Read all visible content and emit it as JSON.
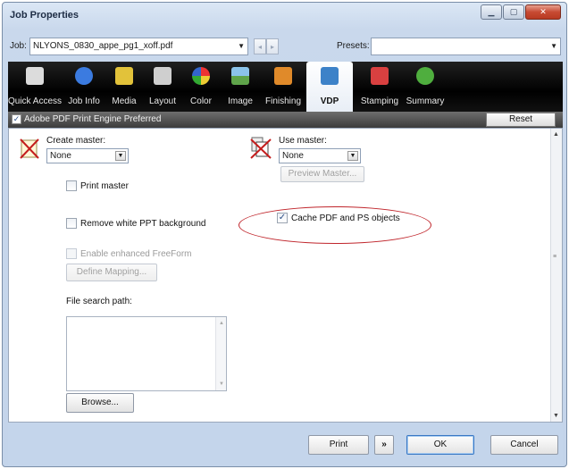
{
  "window": {
    "title": "Job Properties"
  },
  "job": {
    "label": "Job:",
    "value": "NLYONS_0830_appe_pg1_xoff.pdf",
    "presets_label": "Presets:",
    "presets_value": ""
  },
  "tabs": [
    {
      "label": "Quick Access",
      "icon": "quick-access-icon",
      "color": "#d8d8d8"
    },
    {
      "label": "Job Info",
      "icon": "info-icon",
      "color": "#3b7be0"
    },
    {
      "label": "Media",
      "icon": "media-icon",
      "color": "#e2c23a"
    },
    {
      "label": "Layout",
      "icon": "layout-icon",
      "color": "#c9c9c9"
    },
    {
      "label": "Color",
      "icon": "color-wheel-icon",
      "color": "#d83b8d"
    },
    {
      "label": "Image",
      "icon": "image-icon",
      "color": "#5fa44a"
    },
    {
      "label": "Finishing",
      "icon": "finishing-icon",
      "color": "#e08a2a"
    },
    {
      "label": "VDP",
      "icon": "vdp-icon",
      "color": "#3d82c8"
    },
    {
      "label": "Stamping",
      "icon": "stamping-icon",
      "color": "#d94040"
    },
    {
      "label": "Summary",
      "icon": "summary-check-icon",
      "color": "#4fae3e"
    }
  ],
  "active_tab": "VDP",
  "pref": {
    "label": "Adobe PDF Print Engine Preferred",
    "checked": true,
    "reset": "Reset"
  },
  "create_master": {
    "label": "Create master:",
    "value": "None"
  },
  "use_master": {
    "label": "Use master:",
    "value": "None",
    "preview": "Preview Master..."
  },
  "options": {
    "print_master": "Print master",
    "remove_ppt": "Remove white PPT background",
    "enhanced_freeform": "Enable enhanced FreeForm",
    "define_mapping": "Define Mapping...",
    "cache_pdf": "Cache PDF and PS objects"
  },
  "file_search": {
    "label": "File search path:",
    "browse": "Browse..."
  },
  "footer": {
    "print": "Print",
    "more": "»",
    "ok": "OK",
    "cancel": "Cancel"
  },
  "colors": {
    "highlight_oval": "#c0262c",
    "accent_ok": "#3a78c4"
  }
}
